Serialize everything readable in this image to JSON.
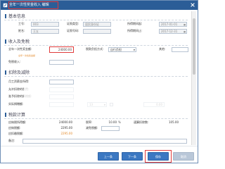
{
  "window": {
    "title": "全年一次性奖金收入 编辑"
  },
  "sections": {
    "basic": "基本信息",
    "income": "收入及免税",
    "deduct": "扣除及减除",
    "tax": "税款计算"
  },
  "basic": {
    "id_no_label": "工号:",
    "id_no_value": "003",
    "name_label": "姓名:",
    "name_value": "王五",
    "idtype_label": "证照类型:",
    "idtype_value": "居民身份证",
    "idnum_label": "证照号码:",
    "idnum_value": "",
    "start_label": "所得期间起:",
    "start_value": "2017-01-01",
    "end_label": "所得期间止:",
    "end_value": "2017-12-31"
  },
  "income": {
    "bonus_label": "全年一次性奖金额:",
    "bonus_value": "24000.00",
    "bonus_hint": "全年一次性奖金额",
    "taxfree_label": "免税收入:",
    "taxfree_value": "",
    "method_label": "税款负担方式:",
    "method_value": "自行负担",
    "other_label": "其他:",
    "other_value": ""
  },
  "deduct": {
    "monthly_label": "月工资薪金所得:",
    "allowed_label": "允许扣除的税费:",
    "reduce_label": "准予扣除的捐赠额:",
    "actual_label": "实际捐赠额:",
    "actual_value": "",
    "rate_value": "13",
    "deduct_value": "0.00"
  },
  "tax": {
    "taxable_label": "应纳税所得额:",
    "taxable_value": "24000.00",
    "rate_label": "税率:",
    "rate_value": "10.00",
    "rate_unit": "%",
    "quick_label": "速算扣除数:",
    "quick_value": "105.00",
    "payable_label": "应纳税额:",
    "payable_value": "2295.00",
    "reduced_label": "减免税额:",
    "reduced_value": "",
    "withheld_label": "应扣缴税额:",
    "withheld_value": "2295.00",
    "note_label": "备注:"
  },
  "footer": {
    "prev": "上一条",
    "next": "下一条",
    "save": "保存",
    "cancel": "取消"
  }
}
